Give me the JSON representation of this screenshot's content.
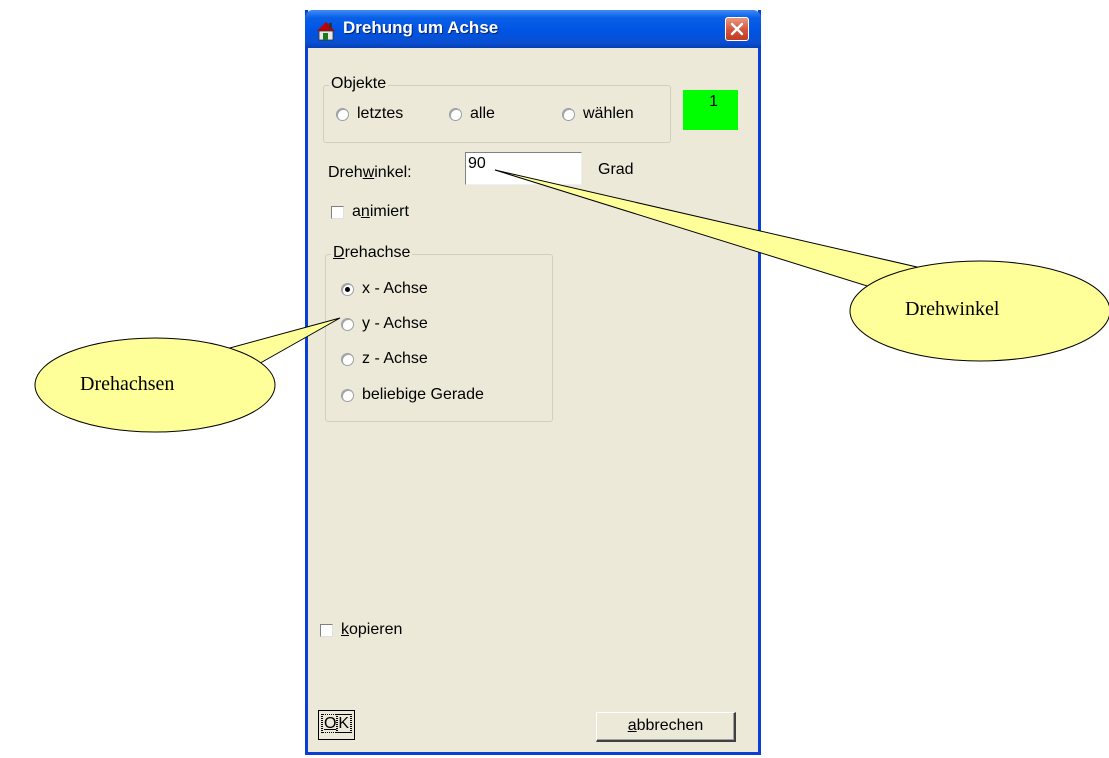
{
  "window": {
    "title": "Drehung um Achse"
  },
  "objekte": {
    "legend_pre": "Ob",
    "legend_ul": "j",
    "legend_post": "ekte",
    "options": [
      "letztes",
      "alle",
      "wählen"
    ],
    "count": "1",
    "count_bg": "#00ff00"
  },
  "drehwinkel": {
    "label_pre": "Dreh",
    "label_ul": "w",
    "label_post": "inkel:",
    "value": "90",
    "unit": "Grad"
  },
  "animiert": {
    "pre": "a",
    "ul": "n",
    "post": "imiert"
  },
  "drehachse": {
    "legend_ul": "D",
    "legend_post": "rehachse",
    "options": [
      "x - Achse",
      "y - Achse",
      "z - Achse",
      "beliebige Gerade"
    ],
    "selected": "x - Achse"
  },
  "kopieren": {
    "ul": "k",
    "post": "opieren"
  },
  "buttons": {
    "ok_ul": "O",
    "ok_post": "K",
    "cancel_ul": "a",
    "cancel_post": "bbrechen"
  },
  "callouts": {
    "drehwinkel": "Drehwinkel",
    "drehachsen": "Drehachsen",
    "fill": "#ffff99"
  },
  "icons": [
    "app-icon",
    "close-icon"
  ]
}
